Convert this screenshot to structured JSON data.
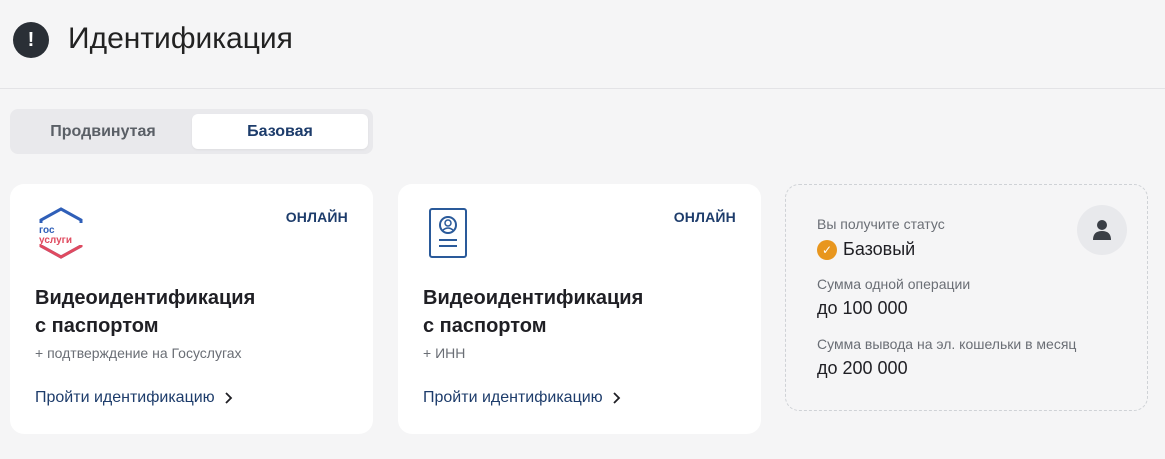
{
  "header": {
    "title": "Идентификация",
    "alert_icon": "!"
  },
  "tabs": [
    {
      "label": "Продвинутая",
      "active": false
    },
    {
      "label": "Базовая",
      "active": true
    }
  ],
  "cards": [
    {
      "icon": "gosuslugi-logo-icon",
      "logo_line1": "гос",
      "logo_line2": "услуги",
      "badge": "ОНЛАЙН",
      "title_line1": "Видеоидентификация",
      "title_line2": "с паспортом",
      "subtitle": "+ подтверждение на Госуслугах",
      "link": "Пройти идентификацию"
    },
    {
      "icon": "id-card-icon",
      "badge": "ОНЛАЙН",
      "title_line1": "Видеоидентификация",
      "title_line2": "с паспортом",
      "subtitle": "+ ИНН",
      "link": "Пройти идентификацию"
    }
  ],
  "status_panel": {
    "status_label": "Вы получите статус",
    "status_value": "Базовый",
    "status_color": "#e8961e",
    "op_label": "Сумма одной операции",
    "op_value": "до 100 000",
    "withdraw_label": "Сумма вывода на эл. кошельки в месяц",
    "withdraw_value": "до 200 000",
    "icon": "user-icon"
  },
  "colors": {
    "accent": "#1d3c6b",
    "background": "#f5f5f6"
  }
}
